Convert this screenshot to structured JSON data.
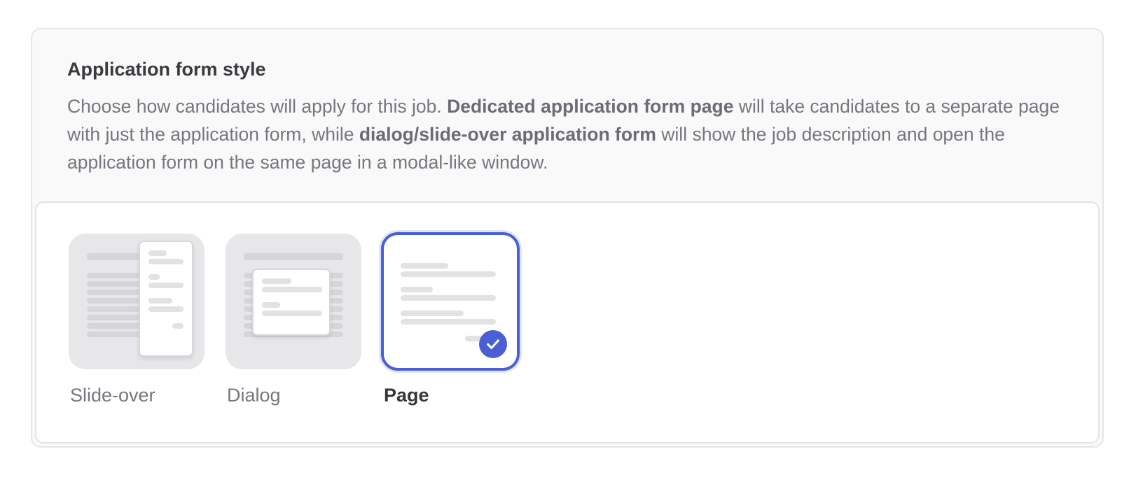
{
  "section": {
    "title": "Application form style",
    "description": {
      "intro": "Choose how candidates will apply for this job. ",
      "bold1": "Dedicated application form page",
      "mid": " will take candidates to a separate page with just the application form, while ",
      "bold2": "dialog/slide-over application form",
      "outro": " will show the job description and open the application form on the same page in a modal-like window."
    }
  },
  "options": [
    {
      "id": "slide-over",
      "label": "Slide-over",
      "selected": false
    },
    {
      "id": "dialog",
      "label": "Dialog",
      "selected": false
    },
    {
      "id": "page",
      "label": "Page",
      "selected": true
    }
  ],
  "colors": {
    "accent": "#4a5fd3",
    "thumb_bg": "#e7e7e9",
    "border": "#e6e6e8"
  },
  "icons": {
    "selected": "checkmark-icon"
  }
}
